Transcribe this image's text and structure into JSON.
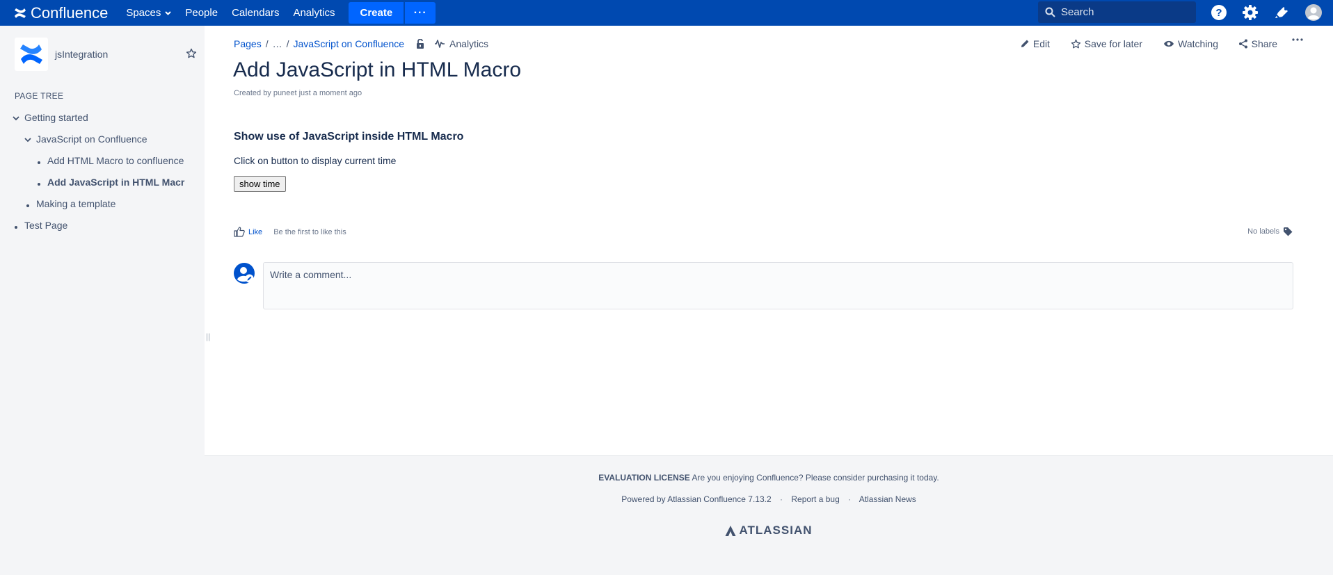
{
  "header": {
    "app_name": "Confluence",
    "nav": [
      "Spaces",
      "People",
      "Calendars",
      "Analytics"
    ],
    "create_label": "Create",
    "more_label": "···",
    "search_placeholder": "Search",
    "icons": [
      "help-icon",
      "settings-icon",
      "notifications-icon",
      "user-avatar-icon"
    ],
    "colors": {
      "bar": "#0049b0",
      "create": "#0065ff"
    }
  },
  "sidebar": {
    "space_name": "jsIntegration",
    "tree_title": "PAGE TREE",
    "tree": [
      {
        "label": "Getting started",
        "level": 0,
        "type": "expanded"
      },
      {
        "label": "JavaScript on Confluence",
        "level": 1,
        "type": "expanded"
      },
      {
        "label": "Add HTML Macro to confluence",
        "level": 2,
        "type": "bullet"
      },
      {
        "label": "Add JavaScript in HTML Macr",
        "level": 2,
        "type": "bullet",
        "current": true
      },
      {
        "label": "Making a template",
        "level": 1,
        "type": "bullet"
      },
      {
        "label": "Test Page",
        "level": 0,
        "type": "bullet"
      }
    ]
  },
  "breadcrumbs": {
    "pages": "Pages",
    "ellipsis": "…",
    "parent": "JavaScript on Confluence",
    "analytics": "Analytics"
  },
  "page_actions": {
    "edit": "Edit",
    "save_for_later": "Save for later",
    "watching": "Watching",
    "share": "Share"
  },
  "page": {
    "title": "Add JavaScript in HTML Macro",
    "byline_prefix": "Created by",
    "author": "puneet",
    "byline_time": "just a moment ago",
    "heading": "Show use of JavaScript inside HTML Macro",
    "paragraph": "Click on button to display current time",
    "button_label": "show time"
  },
  "social": {
    "like": "Like",
    "like_text": "Be the first to like this",
    "labels": "No labels"
  },
  "comment": {
    "placeholder": "Write a comment..."
  },
  "footer": {
    "license_label": "EVALUATION LICENSE",
    "license_text": "Are you enjoying Confluence? Please consider purchasing it today.",
    "powered_by": "Powered by Atlassian Confluence 7.13.2",
    "report_bug": "Report a bug",
    "news": "Atlassian News",
    "brand": "ATLASSIAN"
  }
}
